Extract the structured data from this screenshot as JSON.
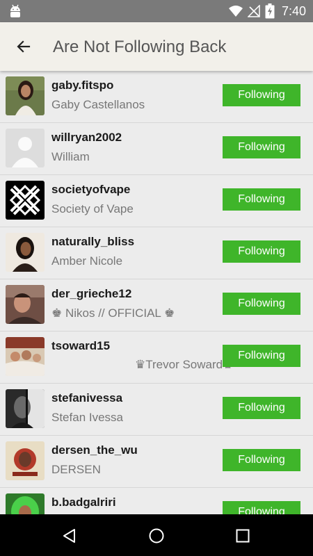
{
  "status_bar": {
    "time": "7:40",
    "icons": [
      "android-icon",
      "wifi-icon",
      "no-signal-icon",
      "battery-charging-icon"
    ]
  },
  "app_bar": {
    "title": "Are Not Following Back",
    "back_icon": "back-arrow-icon"
  },
  "users": [
    {
      "username": "gaby.fitspo",
      "name": "Gaby Castellanos",
      "button": "Following",
      "avatar": "photo-woman"
    },
    {
      "username": "willryan2002",
      "name": "William",
      "button": "Following",
      "avatar": "default-avatar"
    },
    {
      "username": "societyofvape",
      "name": "Society of Vape",
      "button": "Following",
      "avatar": "x-logo"
    },
    {
      "username": "naturally_bliss",
      "name": "Amber Nicole",
      "button": "Following",
      "avatar": "photo-woman"
    },
    {
      "username": "der_grieche12",
      "name": "♚ Nikos // OFFICIAL ♚",
      "button": "Following",
      "avatar": "photo-man"
    },
    {
      "username": "tsoward15",
      "name": "♛Trevor Soward♛",
      "button": "Following",
      "avatar": "photo-group"
    },
    {
      "username": "stefanivessa",
      "name": "Stefan Ivessa",
      "button": "Following",
      "avatar": "photo-man"
    },
    {
      "username": "dersen_the_wu",
      "name": "DERSEN",
      "button": "Following",
      "avatar": "artwork"
    },
    {
      "username": "b.badgalriri",
      "name": "",
      "button": "Following",
      "avatar": "photo-green-hair"
    }
  ],
  "nav_bar": {
    "icons": [
      "back-triangle-icon",
      "home-circle-icon",
      "recents-square-icon"
    ]
  },
  "colors": {
    "status_bar": "#7a7a7a",
    "app_bar": "#f2f0ea",
    "list_background": "#ececec",
    "follow_button": "#3fb52a",
    "nav_bar": "#000000"
  }
}
